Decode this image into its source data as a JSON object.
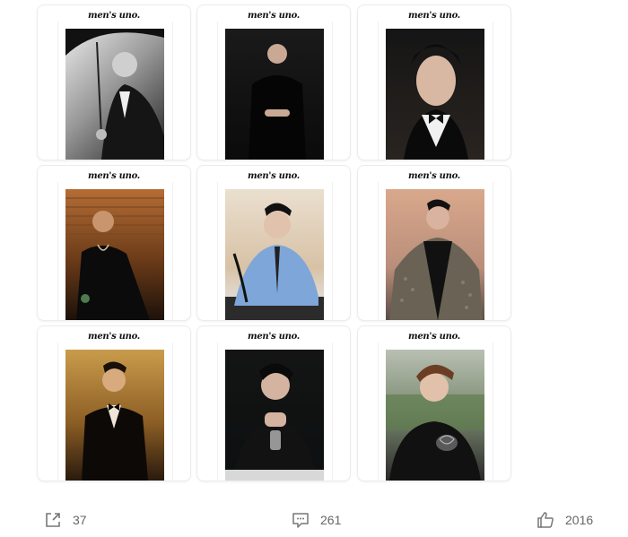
{
  "post": {
    "logo_text": "men's uno.",
    "images": [
      {
        "subject": "man-with-umbrella",
        "palette": "bw"
      },
      {
        "subject": "man-in-black-suit",
        "palette": "dark"
      },
      {
        "subject": "man-with-bow-tie",
        "palette": "dark2"
      },
      {
        "subject": "man-seated-wood-blinds",
        "palette": "wood"
      },
      {
        "subject": "man-in-blue-shirt",
        "palette": "light"
      },
      {
        "subject": "man-in-patterned-jacket",
        "palette": "warm"
      },
      {
        "subject": "man-in-tuxedo-golden",
        "palette": "gold"
      },
      {
        "subject": "man-with-hands-clasped",
        "palette": "deep"
      },
      {
        "subject": "man-in-embroidered-jacket",
        "palette": "garden"
      }
    ]
  },
  "actions": {
    "share": {
      "icon": "share-icon",
      "count": "37"
    },
    "comment": {
      "icon": "comment-icon",
      "count": "261"
    },
    "like": {
      "icon": "thumbs-up-icon",
      "count": "2016"
    }
  }
}
